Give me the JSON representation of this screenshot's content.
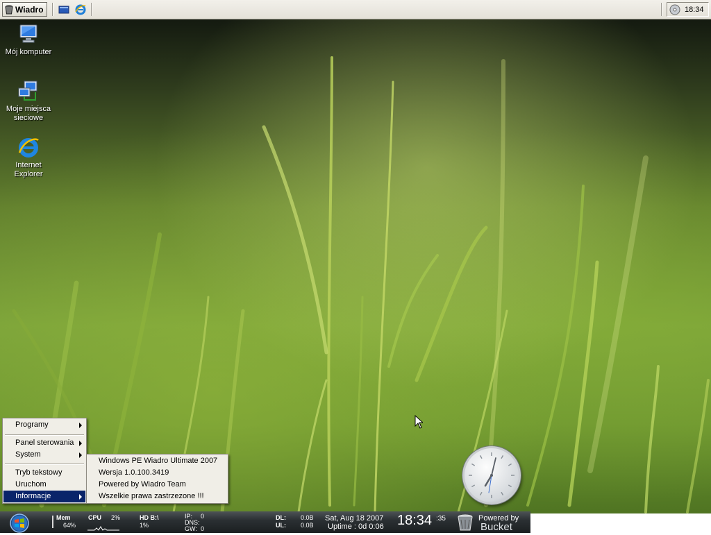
{
  "topbar": {
    "start_label": "Wiadro",
    "clock": "18:34"
  },
  "desktop_icons": [
    {
      "label": "Mój komputer",
      "icon": "computer-icon"
    },
    {
      "label": "Moje miejsca sieciowe",
      "icon": "network-places-icon"
    },
    {
      "label": "Internet Explorer",
      "icon": "internet-explorer-icon"
    }
  ],
  "start_menu": {
    "items": [
      {
        "label": "Programy",
        "has_submenu": true
      },
      {
        "label": "Panel sterowania",
        "has_submenu": true
      },
      {
        "label": "System",
        "has_submenu": true
      },
      {
        "label": "Tryb tekstowy",
        "has_submenu": false
      },
      {
        "label": "Uruchom",
        "has_submenu": false
      },
      {
        "label": "Informacje",
        "has_submenu": true,
        "selected": true
      }
    ],
    "submenu_informacje": [
      "Windows PE Wiadro Ultimate 2007",
      "Wersja 1.0.100.3419",
      "Powered by Wiadro Team",
      "Wszelkie prawa zastrzezone !!!"
    ]
  },
  "status_bar": {
    "mem_label": "Mem",
    "mem_value": "64%",
    "cpu_label": "CPU",
    "cpu_value": "2%",
    "hd_label": "HD B:\\",
    "hd_value": "1%",
    "ip_label": "IP:",
    "ip_value": "0",
    "dns_label": "DNS:",
    "gw_label": "GW:",
    "gw_value": "0",
    "dl_label": "DL:",
    "dl_value": "0.0B",
    "ul_label": "UL:",
    "ul_value": "0.0B",
    "date": "Sat, Aug 18 2007",
    "uptime": "Uptime : 0d 0:06",
    "time": "18:34",
    "seconds": ":35",
    "powered_by": "Powered by",
    "brand": "Bucket"
  },
  "colors": {
    "menu_highlight": "#0a246a",
    "menu_bg": "#f0eee7",
    "wallpaper_green": "#7aa23a"
  }
}
